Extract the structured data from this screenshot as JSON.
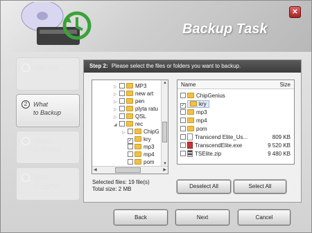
{
  "window": {
    "title": "Backup Task",
    "close_glyph": "✕"
  },
  "steps": [
    {
      "num": "1",
      "label": "Task info",
      "active": false
    },
    {
      "num": "2",
      "label_line1": "What",
      "label_line2": "to Backup",
      "active": true
    },
    {
      "num": "3",
      "label_line1": "Where",
      "label_line2": "to Backup",
      "active": false
    },
    {
      "num": "4",
      "label_line1": "When",
      "label_line2": "to Backup",
      "active": false
    }
  ],
  "panel": {
    "step_label": "Step 2:",
    "instruction": "Please select the files or folders you want to backup."
  },
  "tree": {
    "items": [
      {
        "label": "MP3",
        "checked": false,
        "expander": "▷"
      },
      {
        "label": "new art",
        "checked": false,
        "expander": "▷"
      },
      {
        "label": "pen",
        "checked": false,
        "expander": "▷"
      },
      {
        "label": "plyta ratu",
        "checked": false,
        "expander": "▷"
      },
      {
        "label": "QSL",
        "checked": false,
        "expander": "▷"
      },
      {
        "label": "rec",
        "checked": false,
        "expander": "◢"
      },
      {
        "label": "ChipG",
        "checked": false,
        "expander": "▷"
      },
      {
        "label": "kry",
        "checked": true,
        "expander": ""
      },
      {
        "label": "mp3",
        "checked": false,
        "expander": ""
      },
      {
        "label": "mp4",
        "checked": false,
        "expander": ""
      },
      {
        "label": "pom",
        "checked": false,
        "expander": ""
      }
    ]
  },
  "list": {
    "columns": {
      "name": "Name",
      "size": "Size"
    },
    "rows": [
      {
        "name": "ChipGenius",
        "size": "",
        "type": "folder",
        "checked": false
      },
      {
        "name": "kry",
        "size": "",
        "type": "folder",
        "checked": true,
        "selected": true
      },
      {
        "name": "mp3",
        "size": "",
        "type": "folder",
        "checked": false
      },
      {
        "name": "mp4",
        "size": "",
        "type": "folder",
        "checked": false
      },
      {
        "name": "pom",
        "size": "",
        "type": "folder",
        "checked": false
      },
      {
        "name": "Transcend Elite_Us...",
        "size": "809 KB",
        "type": "file",
        "checked": false
      },
      {
        "name": "TranscendElite.exe",
        "size": "9 520 KB",
        "type": "exe",
        "checked": false
      },
      {
        "name": "TSElite.zip",
        "size": "9 480 KB",
        "type": "zip",
        "checked": false
      }
    ]
  },
  "summary": {
    "selected_files": "Selected files: 19 file(s)",
    "total_size": "Total size: 2 MB"
  },
  "buttons": {
    "deselect_all": "Deselect All",
    "select_all": "Select All",
    "back": "Back",
    "next": "Next",
    "cancel": "Cancel"
  },
  "colors": {
    "panel_header": "#4a4a4a",
    "folder": "#f0c14a",
    "close_button": "#b33333"
  }
}
